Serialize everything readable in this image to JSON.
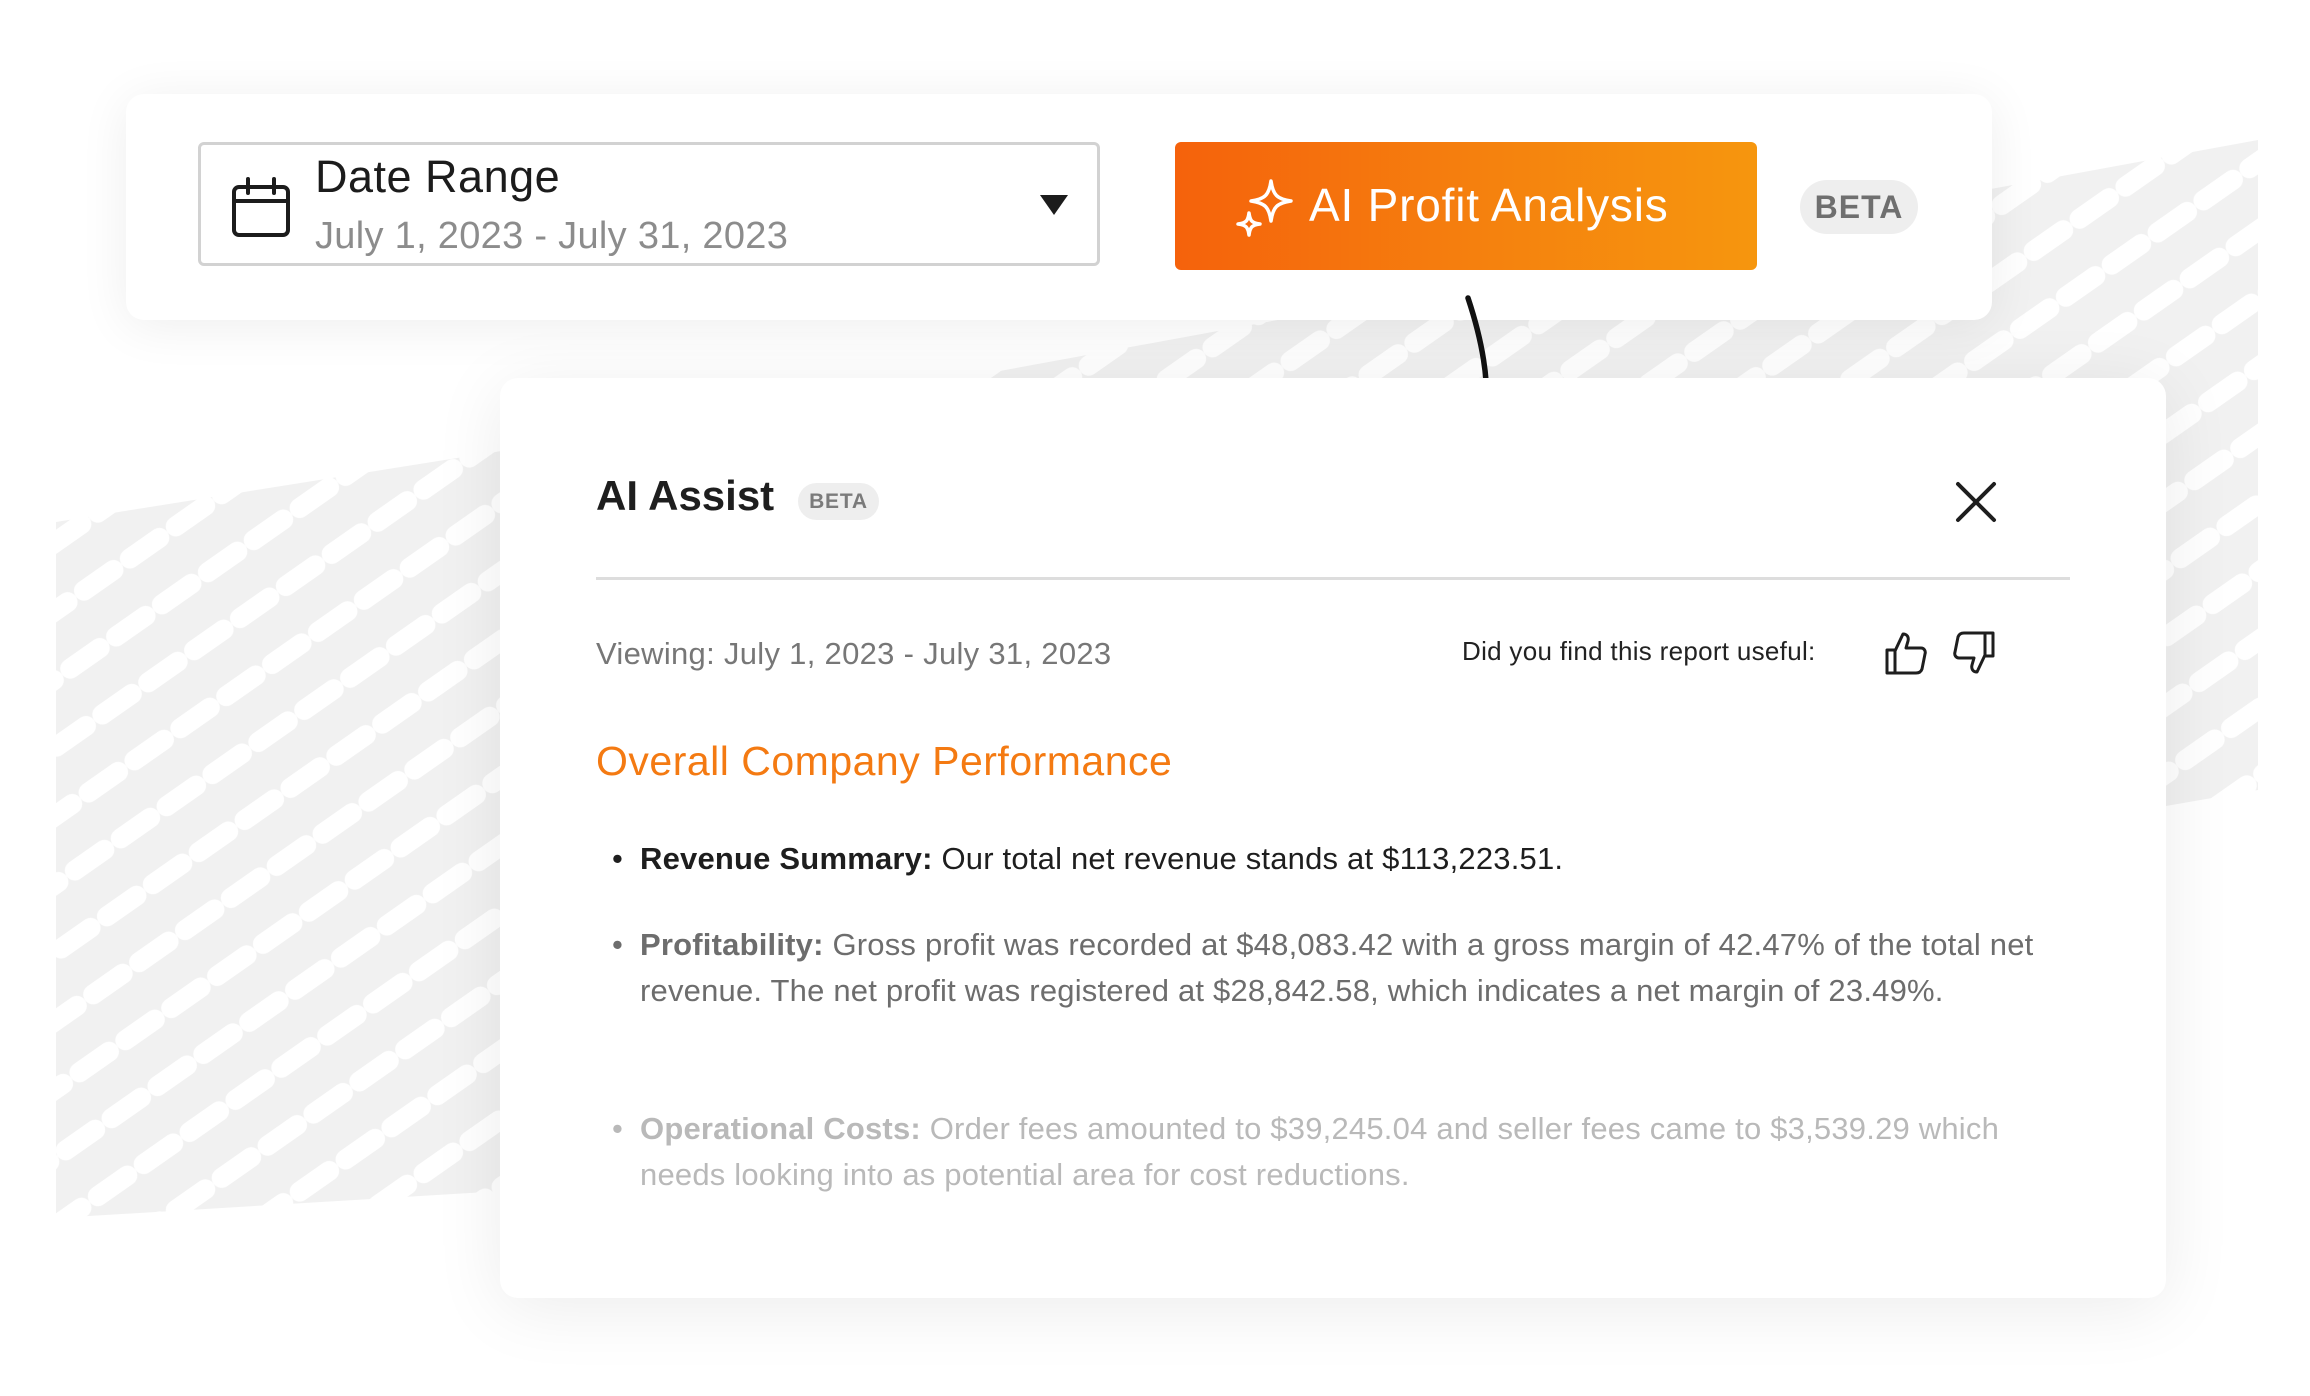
{
  "toolbar": {
    "date_range": {
      "label": "Date Range",
      "value": "July 1, 2023 - July 31, 2023",
      "calendar_icon": "calendar-icon",
      "caret_icon": "caret-down-icon"
    },
    "ai_button": {
      "label": "AI Profit Analysis",
      "icon": "sparkle-icon",
      "gradient_start": "#f5620c",
      "gradient_end": "#f6960e"
    },
    "beta_badge": "BETA"
  },
  "assist_panel": {
    "title": "AI Assist",
    "beta_badge": "BETA",
    "close_icon": "close-icon",
    "viewing": "Viewing: July 1, 2023 - July 31, 2023",
    "feedback_prompt": "Did you find this report useful:",
    "feedback_icons": [
      "thumbs-up-icon",
      "thumbs-down-icon"
    ],
    "section_heading": "Overall Company Performance",
    "accent_color": "#f47a12",
    "bullets": [
      {
        "label": "Revenue Summary:",
        "text": " Our total net revenue stands at $113,223.51."
      },
      {
        "label": "Profitability:",
        "text": " Gross profit was recorded at $48,083.42 with a gross margin of 42.47% of the total net revenue. The net profit was registered at $28,842.58, which indicates a net margin of 23.49%."
      },
      {
        "label": "Operational Costs:",
        "text": " Order fees amounted to $39,245.04 and seller fees came to $3,539.29 which needs looking into as potential area for cost reductions."
      }
    ]
  }
}
